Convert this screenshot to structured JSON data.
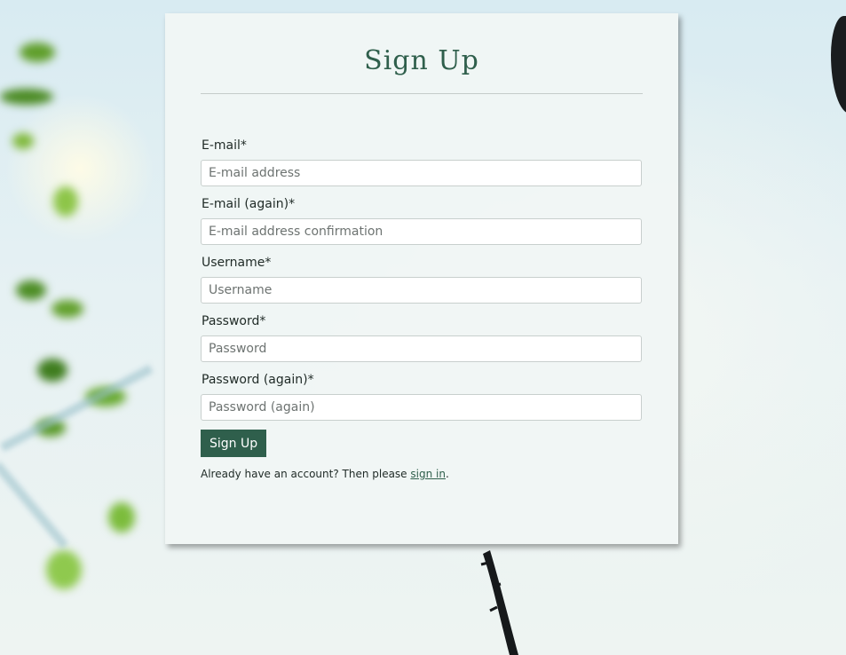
{
  "page": {
    "title": "Sign Up"
  },
  "form": {
    "fields": [
      {
        "label": "E-mail*",
        "placeholder": "E-mail address",
        "value": ""
      },
      {
        "label": "E-mail (again)*",
        "placeholder": "E-mail address confirmation",
        "value": ""
      },
      {
        "label": "Username*",
        "placeholder": "Username",
        "value": ""
      },
      {
        "label": "Password*",
        "placeholder": "Password",
        "value": ""
      },
      {
        "label": "Password (again)*",
        "placeholder": "Password (again)",
        "value": ""
      }
    ],
    "submit_label": "Sign Up"
  },
  "signin": {
    "prefix": "Already have an account? Then please ",
    "link_text": "sign in",
    "suffix": "."
  },
  "colors": {
    "accent": "#2f5f4c",
    "card_background": "#f0f6f5"
  }
}
